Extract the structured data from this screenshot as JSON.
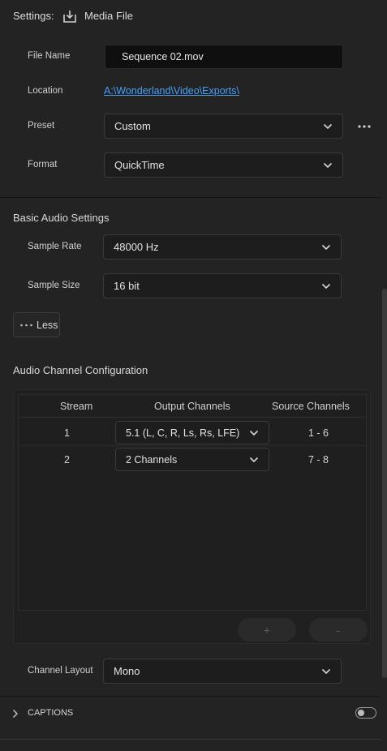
{
  "header": {
    "settings_label": "Settings:",
    "media_file_label": "Media File",
    "media_icon": "export-download-icon"
  },
  "file": {
    "file_name_label": "File Name",
    "file_name_value": "Sequence 02.mov",
    "location_label": "Location",
    "location_value": "A:\\Wonderland\\Video\\Exports\\",
    "preset_label": "Preset",
    "preset_value": "Custom",
    "format_label": "Format",
    "format_value": "QuickTime"
  },
  "audio": {
    "section_title": "Basic Audio Settings",
    "sample_rate_label": "Sample Rate",
    "sample_rate_value": "48000 Hz",
    "sample_size_label": "Sample Size",
    "sample_size_value": "16 bit",
    "less_label": "Less"
  },
  "channel_config": {
    "section_title": "Audio Channel Configuration",
    "headers": {
      "stream": "Stream",
      "output": "Output Channels",
      "source": "Source Channels"
    },
    "rows": [
      {
        "stream": "1",
        "output": "5.1 (L, C, R, Ls, Rs, LFE)",
        "source": "1 - 6"
      },
      {
        "stream": "2",
        "output": "2 Channels",
        "source": "7 - 8"
      }
    ],
    "add_label": "+",
    "remove_label": "-",
    "channel_layout_label": "Channel Layout",
    "channel_layout_value": "Mono"
  },
  "captions": {
    "label": "CAPTIONS",
    "enabled": false
  },
  "colors": {
    "background": "#232323",
    "field": "#1d1d1d",
    "link": "#4a9ff5",
    "text": "#d6d6d6"
  }
}
